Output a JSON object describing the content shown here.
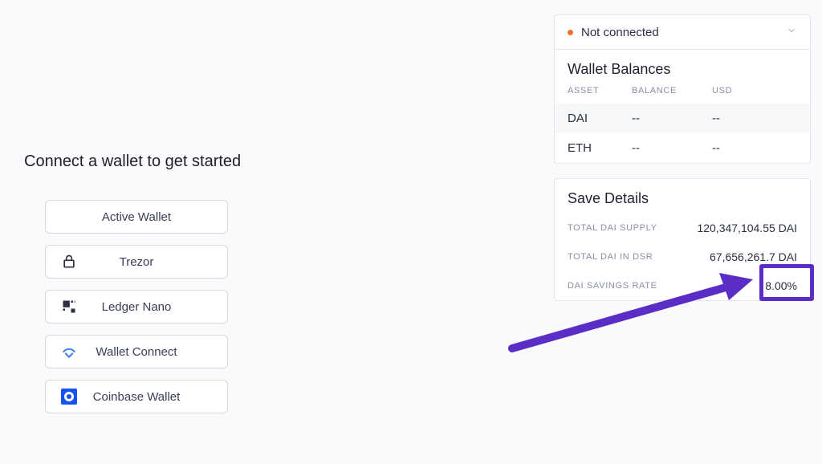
{
  "left": {
    "heading": "Connect a wallet to get started",
    "wallets": [
      {
        "label": "Active Wallet",
        "icon": null
      },
      {
        "label": "Trezor",
        "icon": "lock-icon"
      },
      {
        "label": "Ledger Nano",
        "icon": "ledger-icon"
      },
      {
        "label": "Wallet Connect",
        "icon": "walletconnect-icon"
      },
      {
        "label": "Coinbase Wallet",
        "icon": "coinbase-icon"
      }
    ]
  },
  "connection": {
    "status": "Not connected"
  },
  "balances": {
    "title": "Wallet Balances",
    "columns": {
      "asset": "ASSET",
      "balance": "BALANCE",
      "usd": "USD"
    },
    "rows": [
      {
        "asset": "DAI",
        "balance": "--",
        "usd": "--"
      },
      {
        "asset": "ETH",
        "balance": "--",
        "usd": "--"
      }
    ]
  },
  "save": {
    "title": "Save Details",
    "rows": [
      {
        "k": "TOTAL DAI SUPPLY",
        "v": "120,347,104.55 DAI"
      },
      {
        "k": "TOTAL DAI IN DSR",
        "v": "67,656,261.7 DAI"
      },
      {
        "k": "DAI SAVINGS RATE",
        "v": "8.00%"
      }
    ]
  }
}
